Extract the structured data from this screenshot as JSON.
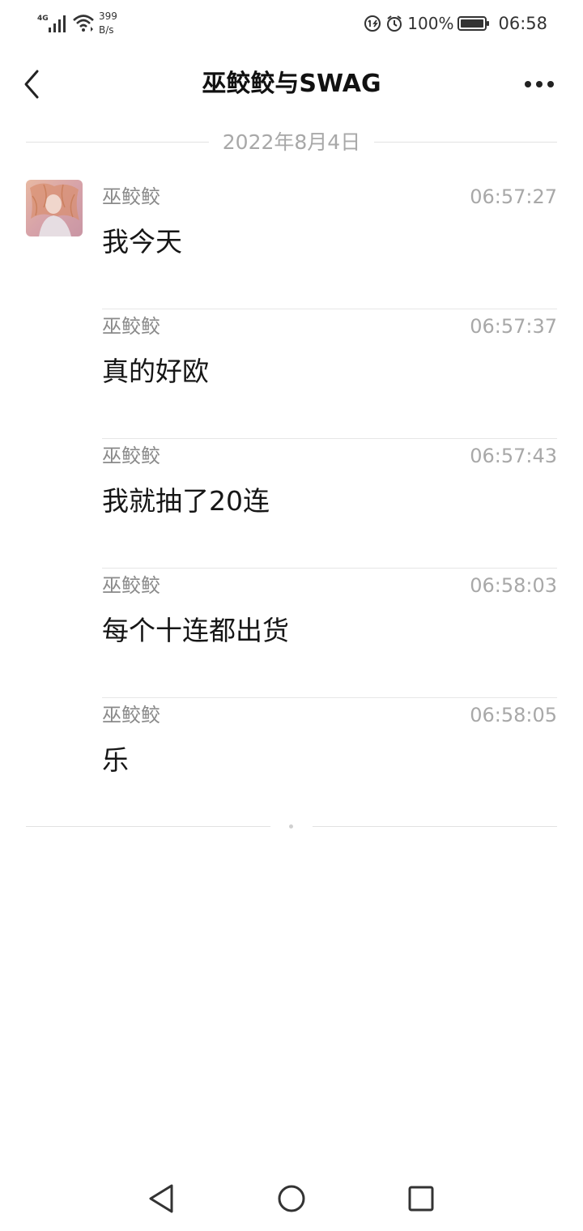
{
  "status_bar": {
    "network": "4G",
    "speed_value": "399",
    "speed_unit": "B/s",
    "battery": "100%",
    "time": "06:58"
  },
  "header": {
    "title": "巫鲛鲛与SWAG",
    "back_icon": "chevron-left-icon",
    "more_icon": "more-dots-icon"
  },
  "date_divider": "2022年8月4日",
  "messages": [
    {
      "sender": "巫鲛鲛",
      "time": "06:57:27",
      "text": "我今天"
    },
    {
      "sender": "巫鲛鲛",
      "time": "06:57:37",
      "text": "真的好欧"
    },
    {
      "sender": "巫鲛鲛",
      "time": "06:57:43",
      "text": "我就抽了20连"
    },
    {
      "sender": "巫鲛鲛",
      "time": "06:58:03",
      "text": "每个十连都出货"
    },
    {
      "sender": "巫鲛鲛",
      "time": "06:58:05",
      "text": "乐"
    }
  ],
  "nav": {
    "back_icon": "triangle-back-icon",
    "home_icon": "circle-home-icon",
    "recents_icon": "square-recents-icon"
  }
}
